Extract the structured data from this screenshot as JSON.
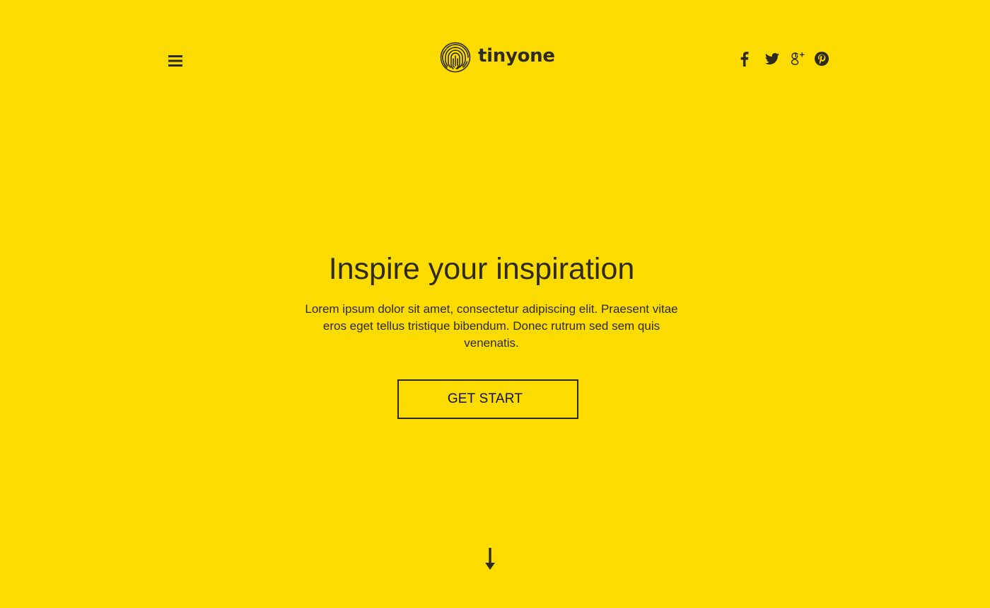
{
  "header": {
    "menu_icon": "hamburger-menu-icon",
    "logo_icon": "fingerprint-icon",
    "brand_name": "tinyone",
    "social": [
      {
        "name": "facebook",
        "icon": "facebook-icon"
      },
      {
        "name": "twitter",
        "icon": "twitter-icon"
      },
      {
        "name": "google-plus",
        "icon": "google-plus-icon"
      },
      {
        "name": "pinterest",
        "icon": "pinterest-icon"
      }
    ]
  },
  "hero": {
    "title": "Inspire your inspiration",
    "text": "Lorem ipsum dolor sit amet, consectetur adipiscing elit. Praesent vitae eros eget tellus tristique bibendum. Donec rutrum sed sem quis venenatis.",
    "button_label": "GET START",
    "scroll_icon": "arrow-down-icon"
  },
  "colors": {
    "background": "#fcdc00",
    "text": "#2e2a1c"
  }
}
